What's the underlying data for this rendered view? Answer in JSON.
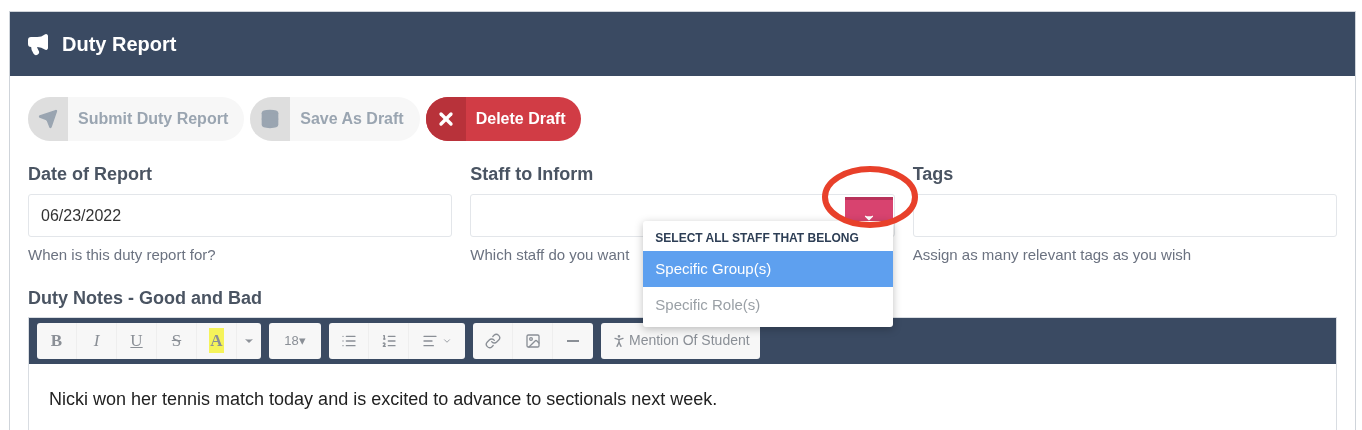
{
  "header": {
    "title": "Duty Report"
  },
  "actions": [
    {
      "label": "Submit Duty Report",
      "kind": "send"
    },
    {
      "label": "Save As Draft",
      "kind": "database"
    },
    {
      "label": "Delete Draft",
      "kind": "delete"
    }
  ],
  "fields": [
    {
      "label": "Date of Report",
      "value": "06/23/2022",
      "hint": "When is this duty report for?",
      "dropdown": false
    },
    {
      "label": "Staff to Inform",
      "hint": "Which staff do you want",
      "dropdown": true
    },
    {
      "label": "Tags",
      "hint": "Assign as many relevant tags as you wish",
      "dropdown": false
    }
  ],
  "dropdown_menu": {
    "header": "SELECT ALL STAFF THAT BELONG",
    "items": [
      {
        "label": "Specific Group(s)",
        "selected": true
      },
      {
        "label": "Specific Role(s)",
        "selected": false
      }
    ]
  },
  "notes": {
    "label": "Duty Notes - Good and Bad",
    "toolbar": [
      [
        {
          "kind": "bold",
          "text": "B"
        },
        {
          "kind": "italic",
          "text": "I"
        },
        {
          "kind": "underline",
          "text": "U"
        },
        {
          "kind": "strike",
          "text": "S"
        },
        {
          "kind": "highlight",
          "text": "A"
        },
        {
          "kind": "caret"
        }
      ],
      [
        {
          "kind": "size",
          "text": "18▾"
        }
      ],
      [
        {
          "kind": "bullets"
        },
        {
          "kind": "numbers"
        },
        {
          "kind": "align"
        }
      ],
      [
        {
          "kind": "link"
        },
        {
          "kind": "image"
        },
        {
          "kind": "rule"
        }
      ],
      [
        {
          "kind": "mention",
          "text": "Mention Of Student"
        }
      ]
    ],
    "content": "Nicki won her tennis match today and is excited to advance to sectionals next week."
  }
}
